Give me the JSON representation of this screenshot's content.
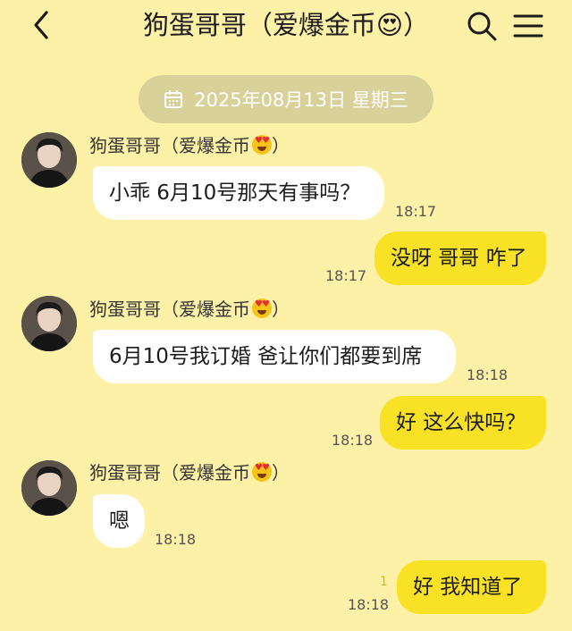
{
  "header": {
    "title": "狗蛋哥哥（爱爆金币😍）"
  },
  "date_separator": {
    "label": "2025年08月13日 星期三"
  },
  "messages": [
    {
      "direction": "in",
      "sender": "狗蛋哥哥（爱爆金币",
      "text": "小乖 6月10号那天有事吗？",
      "time": "18:17"
    },
    {
      "direction": "out",
      "text": "没呀 哥哥 咋了",
      "time": "18:17"
    },
    {
      "direction": "in",
      "sender": "狗蛋哥哥（爱爆金币",
      "text": "6月10号我订婚  爸让你们都要到席",
      "time": "18:18"
    },
    {
      "direction": "out",
      "text": "好 这么快吗？",
      "time": "18:18"
    },
    {
      "direction": "in",
      "sender": "狗蛋哥哥（爱爆金币",
      "text": "嗯",
      "time": "18:18"
    },
    {
      "direction": "out",
      "text": "好 我知道了",
      "time": "18:18",
      "unread": "1"
    }
  ],
  "sender_suffix": "）",
  "icons": {
    "back": "back-chevron-icon",
    "search": "search-icon",
    "menu": "menu-icon",
    "calendar": "calendar-icon",
    "emoji": "heart-eyes-emoji-icon"
  },
  "colors": {
    "background": "#fdf1a8",
    "outgoing_bubble": "#f9e225",
    "incoming_bubble": "#ffffff",
    "date_pill": "#d8d29a"
  }
}
